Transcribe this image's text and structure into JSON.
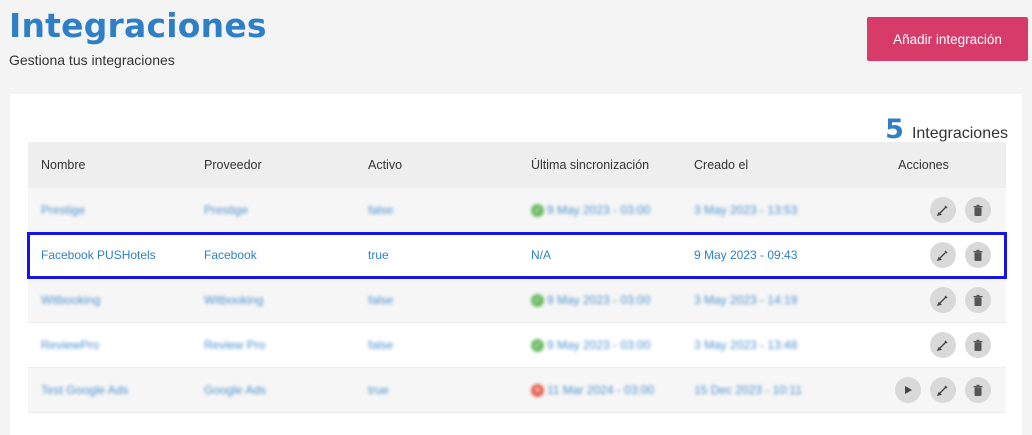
{
  "header": {
    "title": "Integraciones",
    "subtitle": "Gestiona tus integraciones",
    "add_button": "Añadir integración"
  },
  "summary": {
    "count": "5",
    "label": "Integraciones"
  },
  "table": {
    "columns": [
      "Nombre",
      "Proveedor",
      "Activo",
      "Última sincronización",
      "Creado el",
      "Acciones"
    ],
    "rows": [
      {
        "name": "Prestige",
        "provider": "Prestige",
        "active": "false",
        "sync": "9 May 2023 - 03:00",
        "sync_status": "ok",
        "created": "3 May 2023 - 13:53"
      },
      {
        "name": "Facebook PUSHotels",
        "provider": "Facebook",
        "active": "true",
        "sync": "N/A",
        "sync_status": "none",
        "created": "9 May 2023 - 09:43"
      },
      {
        "name": "Witbooking",
        "provider": "Witbooking",
        "active": "false",
        "sync": "9 May 2023 - 03:00",
        "sync_status": "ok",
        "created": "3 May 2023 - 14:19"
      },
      {
        "name": "ReviewPro",
        "provider": "Review Pro",
        "active": "false",
        "sync": "9 May 2023 - 03:00",
        "sync_status": "ok",
        "created": "3 May 2023 - 13:48"
      },
      {
        "name": "Test Google Ads",
        "provider": "Google Ads",
        "active": "true",
        "sync": "11 Mar 2024 - 03:00",
        "sync_status": "error",
        "created": "15 Dec 2023 - 10:11"
      }
    ]
  },
  "colors": {
    "accent": "#2f7fc7",
    "button": "#d63b6a",
    "highlight": "#1515e6",
    "ok": "#52b04a",
    "error": "#e64433"
  }
}
